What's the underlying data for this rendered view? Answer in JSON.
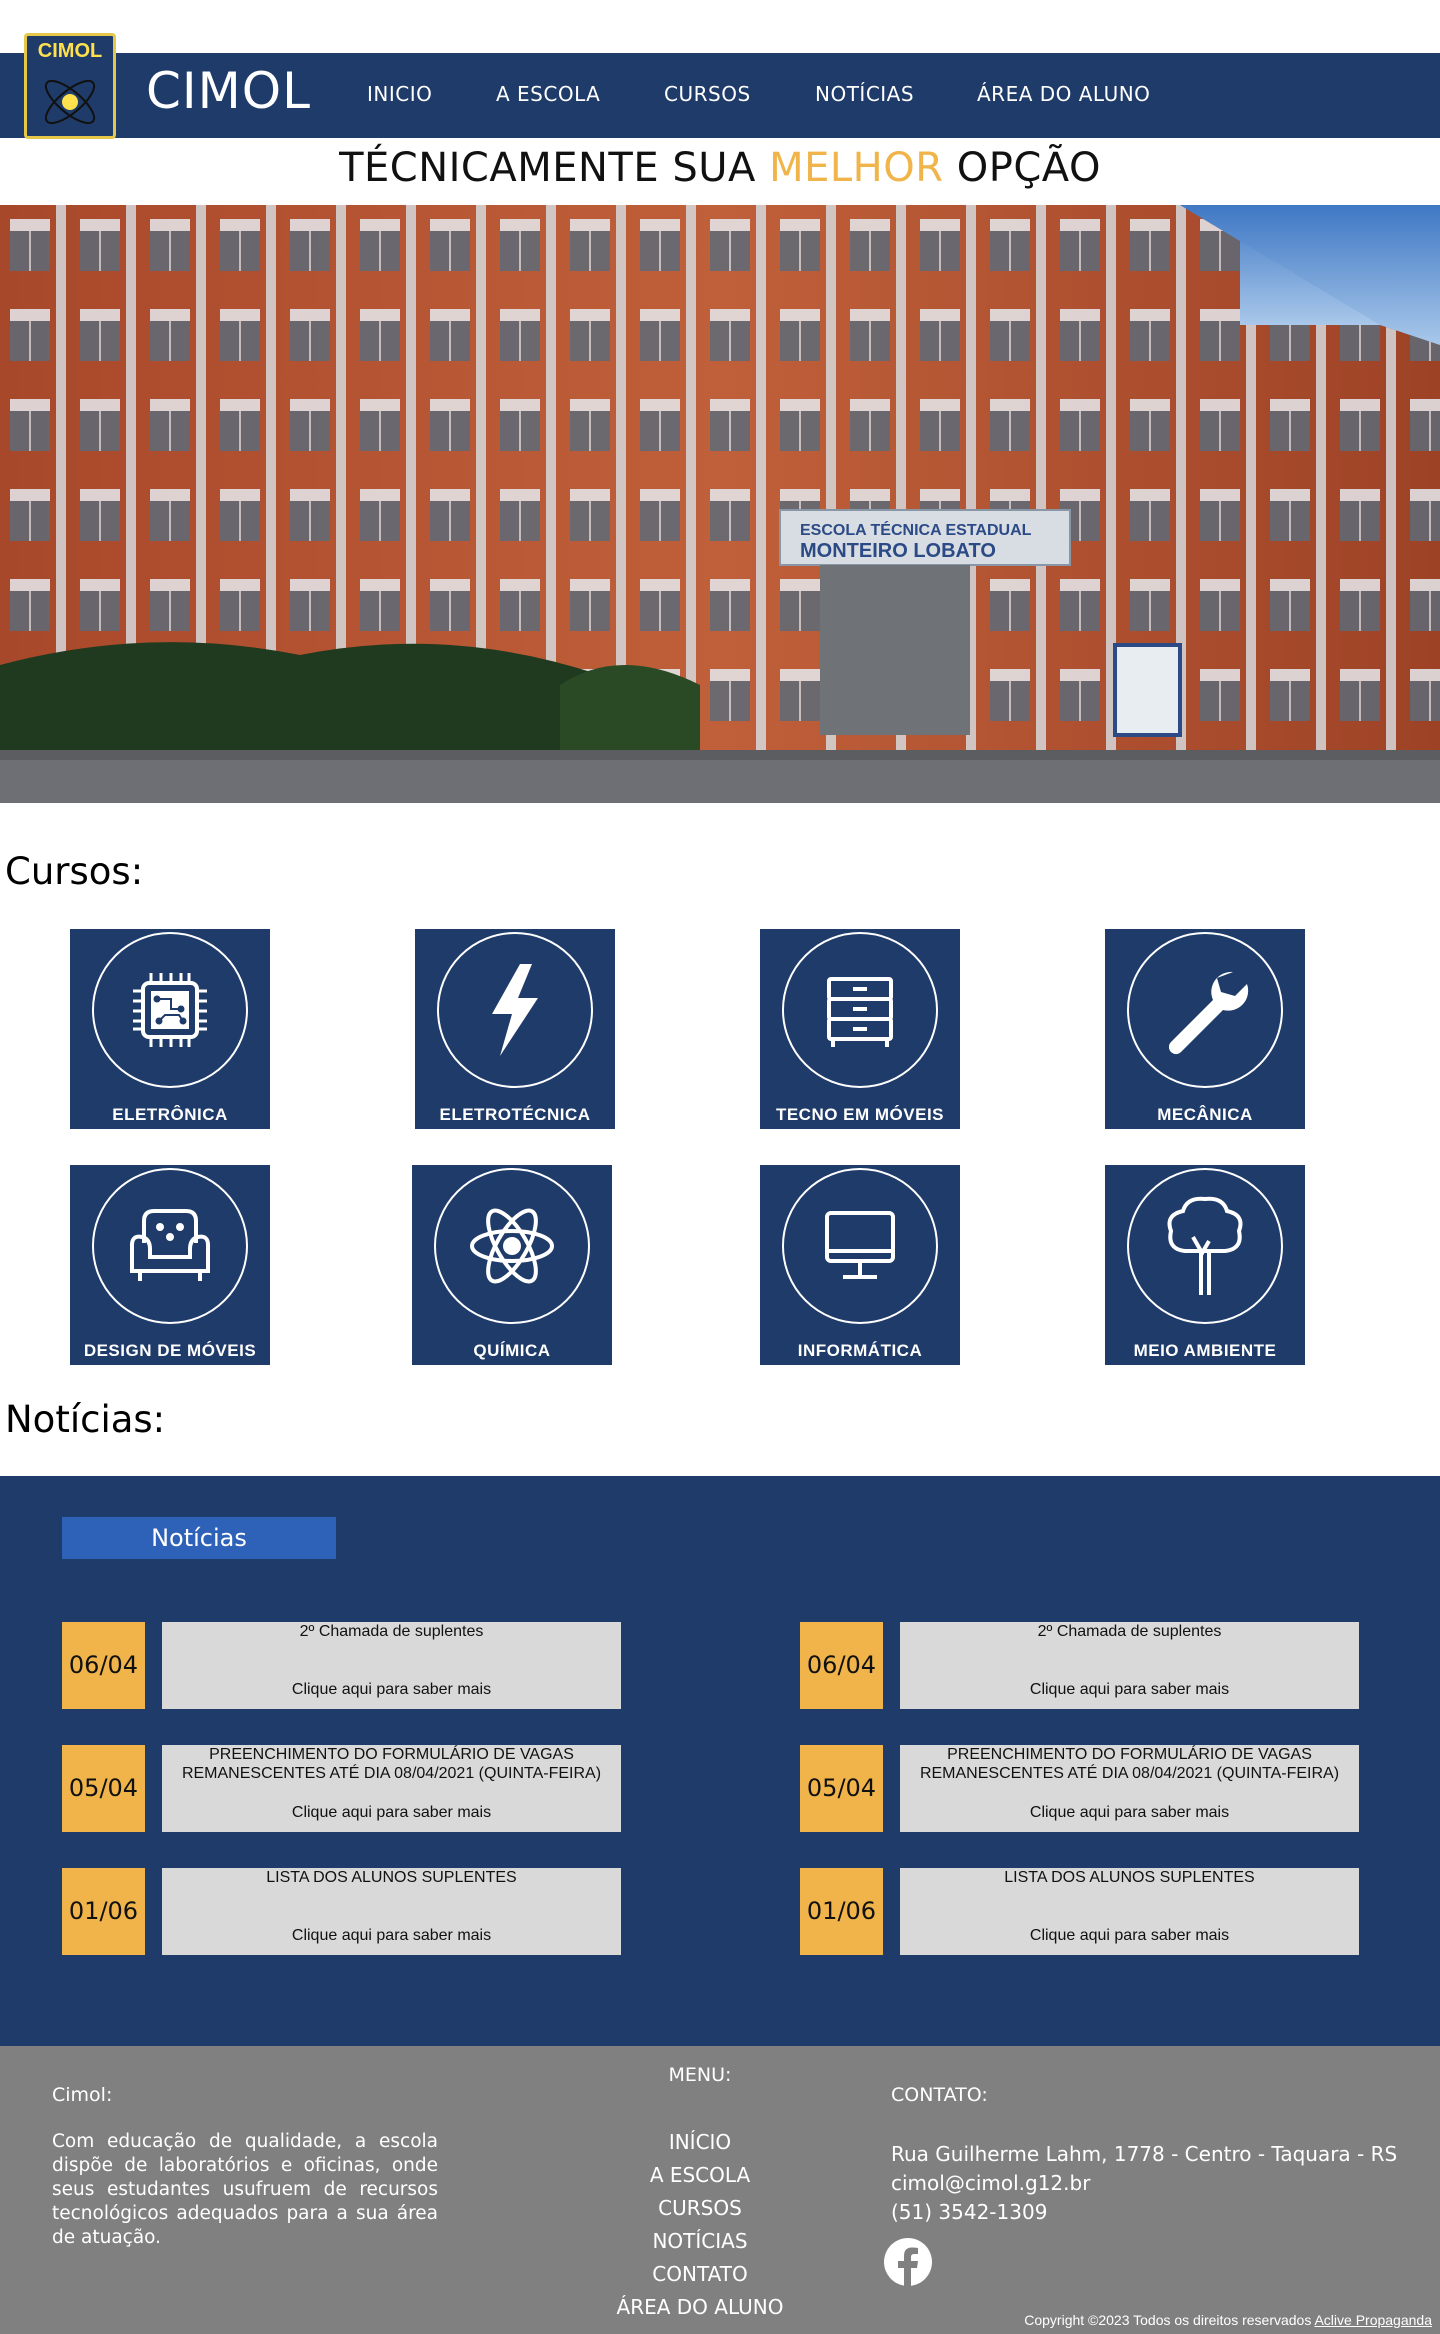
{
  "header": {
    "logo_text": "CIMOL",
    "brand": "CIMOL",
    "nav": [
      "INICIO",
      "A ESCOLA",
      "CURSOS",
      "NOTÍCIAS",
      "ÁREA DO ALUNO"
    ],
    "tagline_part1": "TÉCNICAMENTE SUA ",
    "tagline_highlight": "MELHOR",
    "tagline_part2": " OPÇÃO"
  },
  "hero": {
    "sign_line1": "ESCOLA TÉCNICA ESTADUAL",
    "sign_line2": "MONTEIRO LOBATO"
  },
  "courses_title": "Cursos:",
  "courses": [
    {
      "label": "ELETRÔNICA",
      "icon": "chip-icon"
    },
    {
      "label": "ELETROTÉCNICA",
      "icon": "lightning-icon"
    },
    {
      "label": "TECNO EM MÓVEIS",
      "icon": "drawer-icon"
    },
    {
      "label": "MECÂNICA",
      "icon": "wrench-icon"
    },
    {
      "label": "DESIGN DE MÓVEIS",
      "icon": "armchair-icon"
    },
    {
      "label": "QUÍMICA",
      "icon": "atom-icon"
    },
    {
      "label": "INFORMÁTICA",
      "icon": "monitor-icon"
    },
    {
      "label": "MEIO AMBIENTE",
      "icon": "tree-icon"
    }
  ],
  "news_title": "Notícias:",
  "news": {
    "tab": "Notícias",
    "left": [
      {
        "date": "06/04",
        "title": "2º Chamada de suplentes",
        "more": "Clique aqui para saber mais"
      },
      {
        "date": "05/04",
        "title": "PREENCHIMENTO DO FORMULÁRIO DE VAGAS REMANESCENTES ATÉ DIA 08/04/2021 (QUINTA-FEIRA)",
        "more": "Clique aqui para saber mais"
      },
      {
        "date": "01/06",
        "title": "LISTA DOS ALUNOS SUPLENTES",
        "more": "Clique aqui para saber mais"
      }
    ],
    "right": [
      {
        "date": "06/04",
        "title": "2º Chamada de suplentes",
        "more": "Clique aqui para saber mais"
      },
      {
        "date": "05/04",
        "title": "PREENCHIMENTO DO FORMULÁRIO DE VAGAS REMANESCENTES ATÉ DIA 08/04/2021 (QUINTA-FEIRA)",
        "more": "Clique aqui para saber mais"
      },
      {
        "date": "01/06",
        "title": "LISTA DOS ALUNOS SUPLENTES",
        "more": "Clique aqui para saber mais"
      }
    ]
  },
  "footer": {
    "about_title": "Cimol:",
    "about_text": "Com educação de qualidade, a escola dispõe de laboratórios e oficinas, onde seus estudantes usufruem de recursos tecnológicos adequados para a sua área de atuação.",
    "menu_title": "MENU:",
    "menu": [
      "INÍCIO",
      "A ESCOLA",
      "CURSOS",
      "NOTÍCIAS",
      "CONTATO",
      "ÁREA DO ALUNO"
    ],
    "contact_title": "CONTATO:",
    "address": "Rua Guilherme Lahm, 1778 - Centro - Taquara - RS",
    "email": "cimol@cimol.g12.br",
    "phone": "(51) 3542-1309",
    "social_icon": "facebook-icon",
    "copyright": "Copyright ©2023 Todos os direitos reservados ",
    "copyright_link": "Aclive Propaganda"
  },
  "colors": {
    "navy": "#1f3b6a",
    "accent": "#f0b44a",
    "tab_blue": "#2d62b8",
    "card_gray": "#d9d9d9",
    "footer_gray": "#808080"
  }
}
